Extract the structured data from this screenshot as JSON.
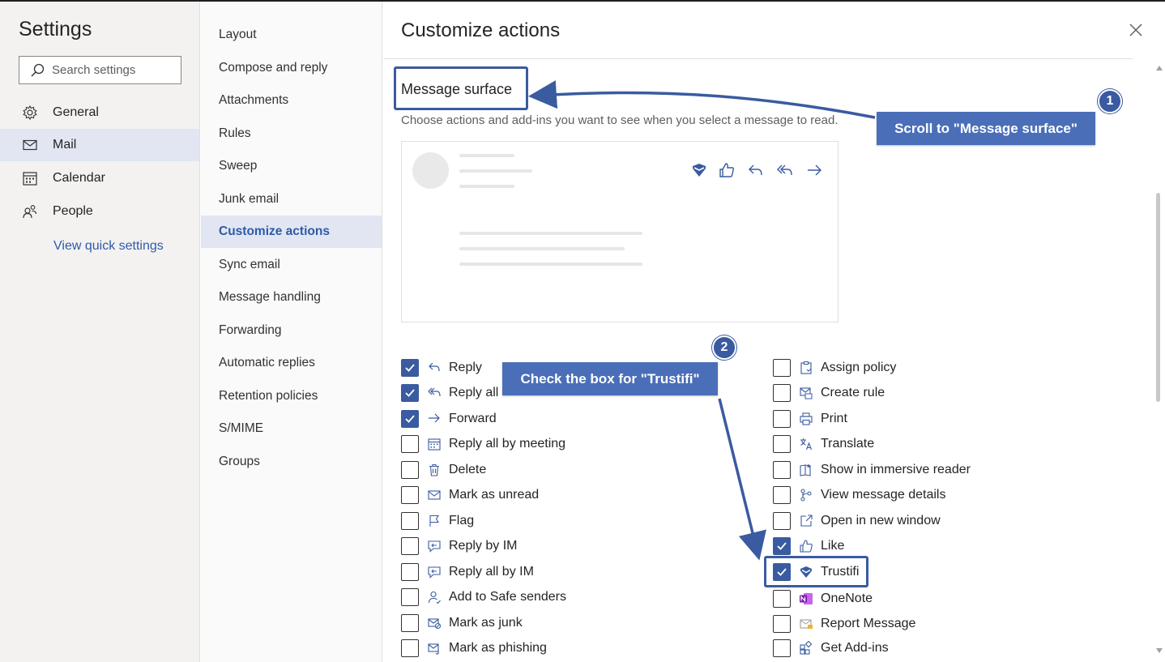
{
  "settings": {
    "title": "Settings",
    "search_placeholder": "Search settings",
    "nav": [
      {
        "label": "General",
        "icon": "gear-icon"
      },
      {
        "label": "Mail",
        "icon": "mail-icon"
      },
      {
        "label": "Calendar",
        "icon": "calendar-icon"
      },
      {
        "label": "People",
        "icon": "people-icon"
      }
    ],
    "quick_settings_link": "View quick settings"
  },
  "mail_menu": {
    "items": [
      "Layout",
      "Compose and reply",
      "Attachments",
      "Rules",
      "Sweep",
      "Junk email",
      "Customize actions",
      "Sync email",
      "Message handling",
      "Forwarding",
      "Automatic replies",
      "Retention policies",
      "S/MIME",
      "Groups"
    ],
    "selected": "Customize actions"
  },
  "panel": {
    "title": "Customize actions",
    "section_title": "Message surface",
    "section_description": "Choose actions and add-ins you want to see when you select a message to read.",
    "preview_toolbar_icons": [
      "trustifi-icon",
      "like-icon",
      "reply-icon",
      "reply-all-icon",
      "forward-icon"
    ],
    "left_options": [
      {
        "label": "Reply",
        "checked": true,
        "icon": "reply-icon"
      },
      {
        "label": "Reply all",
        "checked": true,
        "icon": "reply-all-icon"
      },
      {
        "label": "Forward",
        "checked": true,
        "icon": "forward-icon"
      },
      {
        "label": "Reply all by meeting",
        "checked": false,
        "icon": "calendar-icon"
      },
      {
        "label": "Delete",
        "checked": false,
        "icon": "trash-icon"
      },
      {
        "label": "Mark as unread",
        "checked": false,
        "icon": "envelope-icon"
      },
      {
        "label": "Flag",
        "checked": false,
        "icon": "flag-icon"
      },
      {
        "label": "Reply by IM",
        "checked": false,
        "icon": "chat-icon"
      },
      {
        "label": "Reply all by IM",
        "checked": false,
        "icon": "chat-icon"
      },
      {
        "label": "Add to Safe senders",
        "checked": false,
        "icon": "person-icon"
      },
      {
        "label": "Mark as junk",
        "checked": false,
        "icon": "junk-icon"
      },
      {
        "label": "Mark as phishing",
        "checked": false,
        "icon": "phishing-icon"
      }
    ],
    "right_options": [
      {
        "label": "Assign policy",
        "checked": false,
        "icon": "policy-icon"
      },
      {
        "label": "Create rule",
        "checked": false,
        "icon": "rule-icon"
      },
      {
        "label": "Print",
        "checked": false,
        "icon": "print-icon"
      },
      {
        "label": "Translate",
        "checked": false,
        "icon": "translate-icon"
      },
      {
        "label": "Show in immersive reader",
        "checked": false,
        "icon": "reader-icon"
      },
      {
        "label": "View message details",
        "checked": false,
        "icon": "details-icon"
      },
      {
        "label": "Open in new window",
        "checked": false,
        "icon": "open-window-icon"
      },
      {
        "label": "Like",
        "checked": true,
        "icon": "like-icon"
      },
      {
        "label": "Trustifi",
        "checked": true,
        "icon": "trustifi-icon"
      },
      {
        "label": "OneNote",
        "checked": false,
        "icon": "onenote-icon"
      },
      {
        "label": "Report Message",
        "checked": false,
        "icon": "report-icon"
      },
      {
        "label": "Get Add-ins",
        "checked": false,
        "icon": "addins-icon"
      }
    ]
  },
  "annotations": {
    "step1_number": "1",
    "step1_text": "Scroll to \"Message surface\"",
    "step2_number": "2",
    "step2_text": "Check the box for \"Trustifi\"",
    "accent_color": "#3a5ba0"
  }
}
